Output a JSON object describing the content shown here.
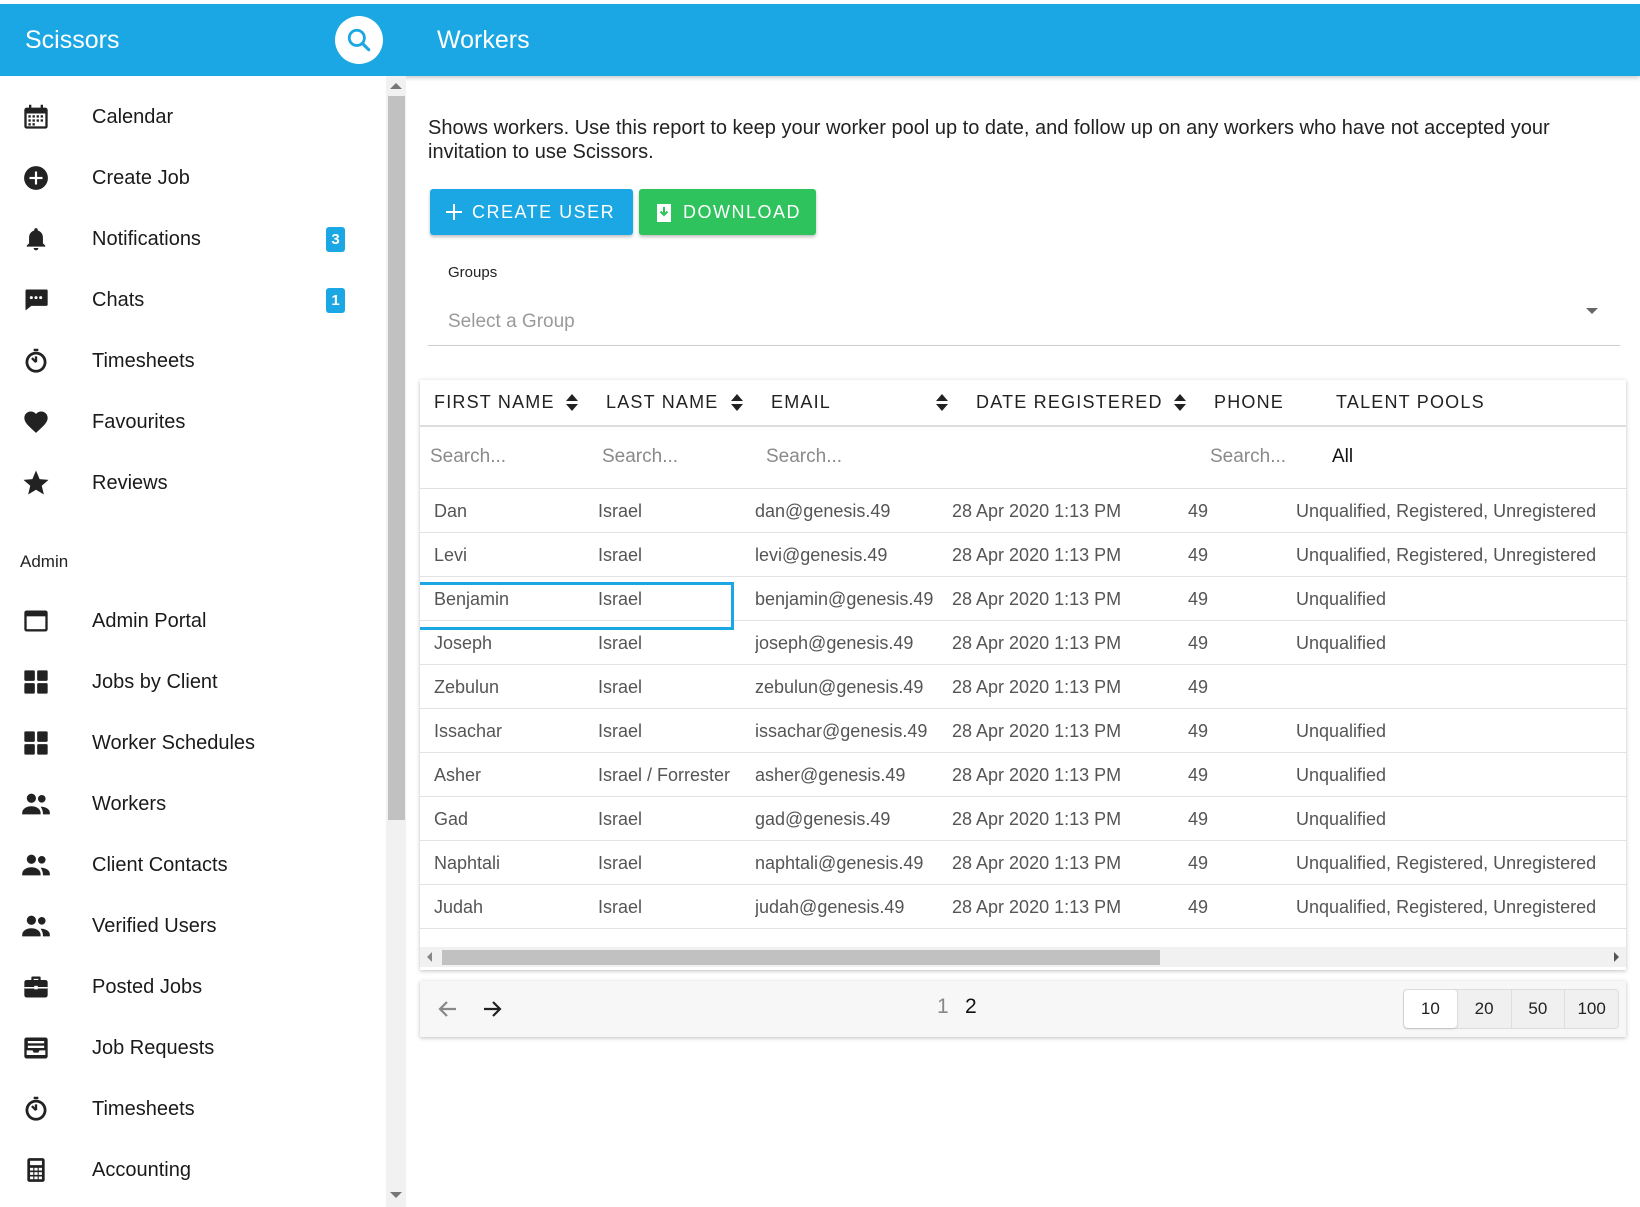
{
  "header": {
    "app_title": "Scissors",
    "page_title": "Workers",
    "search_icon": "search-icon"
  },
  "sidebar": {
    "items": [
      {
        "label": "Calendar",
        "icon": "calendar-icon"
      },
      {
        "label": "Create Job",
        "icon": "add-circle-icon"
      },
      {
        "label": "Notifications",
        "icon": "bell-icon",
        "badge": "3"
      },
      {
        "label": "Chats",
        "icon": "chat-icon",
        "badge": "1"
      },
      {
        "label": "Timesheets",
        "icon": "stopwatch-icon"
      },
      {
        "label": "Favourites",
        "icon": "heart-icon"
      },
      {
        "label": "Reviews",
        "icon": "star-icon"
      }
    ],
    "admin_label": "Admin",
    "admin_items": [
      {
        "label": "Admin Portal",
        "icon": "window-icon"
      },
      {
        "label": "Jobs by Client",
        "icon": "grid-icon"
      },
      {
        "label": "Worker Schedules",
        "icon": "grid-icon"
      },
      {
        "label": "Workers",
        "icon": "people-icon"
      },
      {
        "label": "Client Contacts",
        "icon": "people-icon"
      },
      {
        "label": "Verified Users",
        "icon": "people-icon"
      },
      {
        "label": "Posted Jobs",
        "icon": "briefcase-icon"
      },
      {
        "label": "Job Requests",
        "icon": "inbox-icon"
      },
      {
        "label": "Timesheets",
        "icon": "stopwatch-icon"
      },
      {
        "label": "Accounting",
        "icon": "calculator-icon"
      }
    ]
  },
  "main": {
    "description": "Shows workers. Use this report to keep your worker pool up to date, and follow up on any workers who have not accepted your invitation to use Scissors.",
    "create_user_label": "CREATE USER",
    "download_label": "DOWNLOAD",
    "groups_label": "Groups",
    "groups_placeholder": "Select a Group"
  },
  "table": {
    "columns": [
      "FIRST NAME",
      "LAST NAME",
      "EMAIL",
      "DATE REGISTERED",
      "PHONE",
      "TALENT POOLS"
    ],
    "filters": {
      "first_name": "Search...",
      "last_name": "Search...",
      "email": "Search...",
      "phone": "Search...",
      "talent_pools": "All"
    },
    "rows": [
      {
        "first": "Dan",
        "last": "Israel",
        "email": "dan@genesis.49",
        "date": "28 Apr 2020 1:13 PM",
        "phone": "49",
        "pools": "Unqualified, Registered, Unregistered"
      },
      {
        "first": "Levi",
        "last": "Israel",
        "email": "levi@genesis.49",
        "date": "28 Apr 2020 1:13 PM",
        "phone": "49",
        "pools": "Unqualified, Registered, Unregistered"
      },
      {
        "first": "Benjamin",
        "last": "Israel",
        "email": "benjamin@genesis.49",
        "date": "28 Apr 2020 1:13 PM",
        "phone": "49",
        "pools": "Unqualified"
      },
      {
        "first": "Joseph",
        "last": "Israel",
        "email": "joseph@genesis.49",
        "date": "28 Apr 2020 1:13 PM",
        "phone": "49",
        "pools": "Unqualified"
      },
      {
        "first": "Zebulun",
        "last": "Israel",
        "email": "zebulun@genesis.49",
        "date": "28 Apr 2020 1:13 PM",
        "phone": "49",
        "pools": ""
      },
      {
        "first": "Issachar",
        "last": "Israel",
        "email": "issachar@genesis.49",
        "date": "28 Apr 2020 1:13 PM",
        "phone": "49",
        "pools": "Unqualified"
      },
      {
        "first": "Asher",
        "last": "Israel / Forrester",
        "email": "asher@genesis.49",
        "date": "28 Apr 2020 1:13 PM",
        "phone": "49",
        "pools": "Unqualified"
      },
      {
        "first": "Gad",
        "last": "Israel",
        "email": "gad@genesis.49",
        "date": "28 Apr 2020 1:13 PM",
        "phone": "49",
        "pools": "Unqualified"
      },
      {
        "first": "Naphtali",
        "last": "Israel",
        "email": "naphtali@genesis.49",
        "date": "28 Apr 2020 1:13 PM",
        "phone": "49",
        "pools": "Unqualified, Registered, Unregistered"
      },
      {
        "first": "Judah",
        "last": "Israel",
        "email": "judah@genesis.49",
        "date": "28 Apr 2020 1:13 PM",
        "phone": "49",
        "pools": "Unqualified, Registered, Unregistered"
      }
    ]
  },
  "pagination": {
    "pages": [
      "1",
      "2"
    ],
    "page_sizes": [
      "10",
      "20",
      "50",
      "100"
    ]
  },
  "colors": {
    "primary": "#1ba7e3",
    "success": "#2ec35c"
  }
}
